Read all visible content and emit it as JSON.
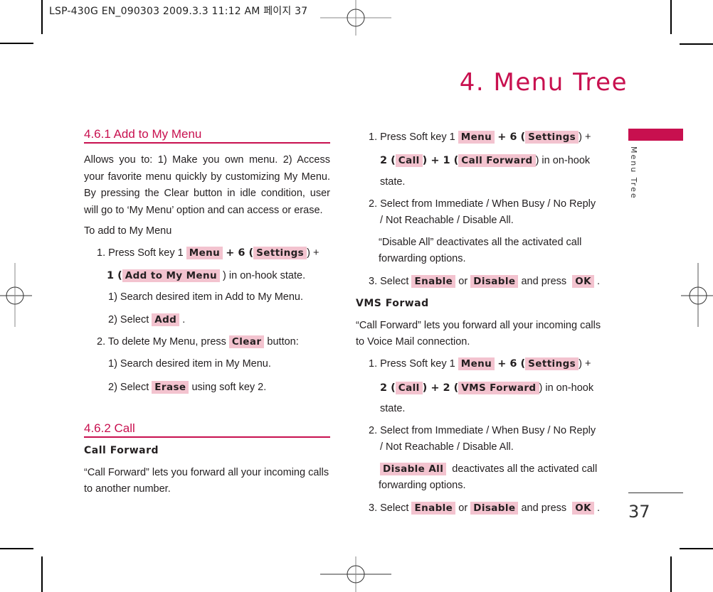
{
  "print_header": "LSP-430G EN_090303  2009.3.3 11:12 AM  페이지 37",
  "page_title": "4. Menu Tree",
  "side_label": "Menu Tree",
  "page_number": "37",
  "colors": {
    "accent": "#c8104f",
    "highlight": "#f3c3cf",
    "text": "#231f20"
  },
  "left": {
    "section1": {
      "title": "4.6.1 Add to My Menu",
      "intro": "Allows you to: 1) Make you own menu. 2) Access your favorite menu quickly by customizing My Menu. By pressing the Clear button in idle condition, user will go to ‘My Menu’ option and can access or erase.",
      "to_add": "To add to My Menu",
      "step1": {
        "prefix": "1. Press Soft key 1",
        "menu": "Menu",
        "plus6": "+ 6 (",
        "settings": "Settings",
        "close_plus": ") +",
        "one": "1 (",
        "add_to_my_menu": "Add to My Menu",
        "suffix": ") in on-hook state."
      },
      "sub1": "1) Search desired item in Add to My Menu.",
      "sub2_prefix": "2) Select",
      "sub2_key": "Add",
      "sub2_suffix": ".",
      "step2_prefix": "2. To delete My Menu, press",
      "step2_key": "Clear",
      "step2_suffix": "button:",
      "sub3": "1) Search desired item in My Menu.",
      "sub4_prefix": "2) Select",
      "sub4_key": "Erase",
      "sub4_suffix": "using soft key 2."
    },
    "section2": {
      "title": "4.6.2 Call",
      "subtitle": "Call Forward",
      "desc_line1": "“Call Forward”  lets you forward all your incoming calls",
      "desc_line2": "to another number."
    }
  },
  "right": {
    "cf_step1": {
      "prefix": "1. Press Soft key 1",
      "menu": "Menu",
      "plus6": "+ 6 (",
      "settings": "Settings",
      "close_plus": ") +",
      "two": "2 (",
      "call": "Call",
      "plus1": ") + 1 (",
      "call_forward": "Call Forward",
      "suffix": ") in  on-hook",
      "state": "state."
    },
    "cf_step2_line1": "2. Select from Immediate / When Busy / No Reply",
    "cf_step2_line2": "/ Not Reachable / Disable All.",
    "cf_note_line1": "“Disable All” deactivates all the activated call",
    "cf_note_line2": "forwarding options.",
    "cf_step3": {
      "prefix": "3. Select",
      "enable": "Enable",
      "or": "or",
      "disable": "Disable",
      "and_press": "and press",
      "ok": "OK",
      "end": "."
    },
    "vms_title": "VMS Forwad",
    "vms_desc_line1": "“Call Forward” lets you forward all your incoming calls",
    "vms_desc_line2": "to Voice Mail connection.",
    "vms_step1": {
      "prefix": "1. Press Soft key 1",
      "menu": "Menu",
      "plus6": "+ 6 (",
      "settings": "Settings",
      "close_plus": ") +",
      "two": "2 (",
      "call": "Call",
      "plus2": ")  + 2 (",
      "vms_forward": "VMS Forward",
      "suffix": ") in on-hook",
      "state": "state."
    },
    "vms_step2_line1": "2. Select from Immediate / When Busy / No Reply",
    "vms_step2_line2": "/ Not Reachable / Disable All.",
    "vms_note_key": "Disable All",
    "vms_note_line1": "deactivates all the activated call",
    "vms_note_line2": "forwarding options.",
    "vms_step3": {
      "prefix": "3. Select",
      "enable": "Enable",
      "or": "or",
      "disable": "Disable",
      "and_press": "and press",
      "ok": "OK",
      "end": "."
    }
  }
}
